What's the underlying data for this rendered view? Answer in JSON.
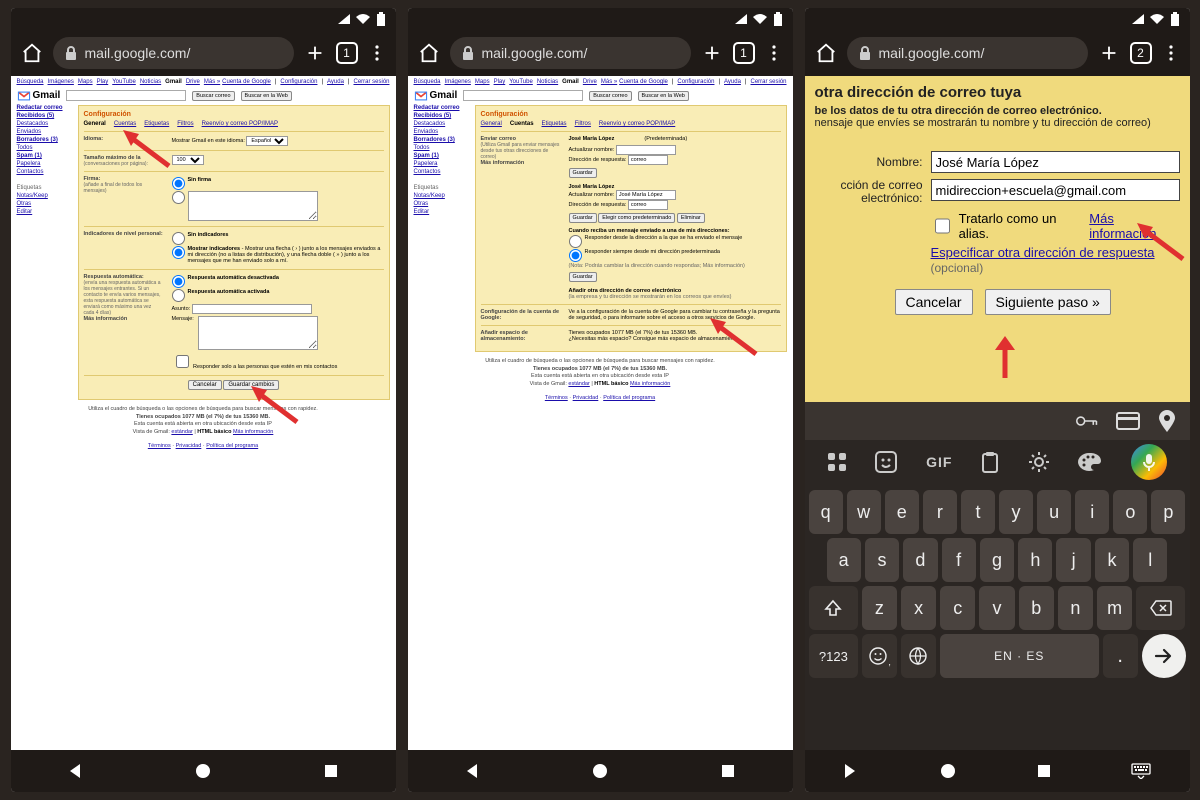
{
  "browser": {
    "url": "mail.google.com/",
    "tab_count_a": "1",
    "tab_count_b": "2"
  },
  "gmail_top": {
    "links": [
      "Búsqueda",
      "Imágenes",
      "Maps",
      "Play",
      "YouTube",
      "Noticias",
      "Gmail",
      "Drive",
      "Más »"
    ],
    "account_links": [
      "Cuenta de Google",
      "Configuración",
      "Ayuda",
      "Cerrar sesión"
    ],
    "logo": "Gmail",
    "btn_search_mail": "Buscar correo",
    "btn_search_web": "Buscar en la Web"
  },
  "sidebar": {
    "items": [
      "Redactar correo",
      "Recibidos (5)",
      "Destacados",
      "Enviados",
      "Borradores (3)",
      "Todos",
      "Spam (1)",
      "Papelera",
      "Contactos"
    ],
    "section": "Etiquetas",
    "labels": [
      "Notas/Keep",
      "Otras",
      "Editar"
    ]
  },
  "config": {
    "title": "Configuración",
    "tabs": [
      "General",
      "Cuentas",
      "Etiquetas",
      "Filtros",
      "Reenvío y correo POP/IMAP"
    ],
    "active_tab_p1": 0,
    "active_tab_p2": 1
  },
  "p1_rows": {
    "idioma": {
      "label": "Idioma:",
      "val_label": "Mostrar Gmail en este idioma:",
      "select": "Español"
    },
    "tamano": {
      "label": "Tamaño máximo de la",
      "sub": "(conversaciones por página):",
      "select": "100"
    },
    "firma": {
      "label": "Firma:",
      "sub": "(añade a final de todos los mensajes)",
      "radio1": "Sin firma"
    },
    "indicadores": {
      "label": "Indicadores de nivel personal:",
      "radio1": "Sin indicadores",
      "radio2": "Mostrar indicadores",
      "desc": "- Mostrar una flecha ( › ) junto a los mensajes enviados a mi dirección (no a listas de distribución), y una flecha doble ( » ) junto a los mensajes que me han enviado solo a mí."
    },
    "respuesta": {
      "label": "Respuesta automática:",
      "sub": "(envía una respuesta automática a los mensajes entrantes. Si un contacto te envía varios mensajes, esta respuesta automática se enviará como máximo una vez cada 4 días)",
      "more": "Más información",
      "radio1": "Respuesta automática desactivada",
      "radio2": "Respuesta automática activada",
      "asunto": "Asunto:",
      "mensaje": "Mensaje:",
      "chk": "Responder solo a las personas que estén en mis contactos"
    },
    "actions": {
      "cancel": "Cancelar",
      "save": "Guardar cambios"
    }
  },
  "p2_rows": {
    "enviar": {
      "label": "Enviar correo",
      "sub": "(Utiliza Gmail para enviar mensajes desde tus otras direcciones de correo)",
      "more": "Más información",
      "col_name": "José María López",
      "col_default": "(Predeterminada)",
      "actualizar_nombre": "Actualizar nombre:",
      "direccion_respuesta": "Dirección de respuesta:",
      "resp_val": "correo",
      "btn_guardar": "Guardar",
      "seg_nombre": "José María López",
      "btn_elegir": "Elegir como predeterminado",
      "btn_eliminar": "Eliminar",
      "cuando": "Cuando reciba un mensaje enviado a una de mis direcciones:",
      "opt1": "Responder desde la dirección a la que se ha enviado el mensaje",
      "opt2": "Responder siempre desde mi dirección predeterminada",
      "nota": "(Nota: Podrás cambiar la dirección cuando respondas; Más información)",
      "add_link": "Añadir otra dirección de correo electrónico",
      "add_sub": "(la empresa y tu dirección se mostrarán en los correos que envíes)"
    },
    "config_google": {
      "label": "Configuración de la cuenta de Google:",
      "text": "Ve a la configuración de la cuenta de Google para cambiar tu contraseña y la pregunta de seguridad, o para informarte sobre el acceso a otros servicios de Google."
    },
    "storage": {
      "label": "Añadir espacio de almacenamiento:",
      "line1": "Tienes ocupados 1077 MB (el 7%) de tus 15360 MB.",
      "line2": "¿Necesitas más espacio? Consigue más espacio de almacenamiento"
    }
  },
  "footer": {
    "search_tip": "Utiliza el cuadro de búsqueda o las opciones de búsqueda para buscar mensajes con rapidez.",
    "storage": "Tienes ocupados 1077 MB (el 7%) de tus 15360 MB.",
    "activity": "Esta cuenta está abierta en otra ubicación desde esta IP",
    "view1": "Vista de Gmail:",
    "estandar": "estándar",
    "html": "HTML básico",
    "more": "Más información",
    "bottom": [
      "Términos",
      "Privacidad",
      "Política del programa"
    ]
  },
  "p3": {
    "title": "otra dirección de correo tuya",
    "sub1": "be los datos de tu otra dirección de correo electrónico.",
    "sub2": "nensaje que envíes se mostrarán tu nombre y tu dirección de correo)",
    "lbl_nombre": "Nombre:",
    "val_nombre": "José María López",
    "lbl_direccion": "cción de correo electrónico:",
    "val_direccion": "midireccion+escuela@gmail.com",
    "alias": "Tratarlo como un alias.",
    "more": "Más información",
    "spec": "Especificar otra dirección de respuesta",
    "opt": "(opcional)",
    "btn_cancel": "Cancelar",
    "btn_next": "Siguiente paso »"
  },
  "keyboard": {
    "gif": "GIF",
    "rows": [
      [
        "q",
        "w",
        "e",
        "r",
        "t",
        "y",
        "u",
        "i",
        "o",
        "p"
      ],
      [
        "a",
        "s",
        "d",
        "f",
        "g",
        "h",
        "j",
        "k",
        "l"
      ],
      [
        "⇧",
        "z",
        "x",
        "c",
        "v",
        "b",
        "n",
        "m",
        "⌫"
      ],
      [
        "?123",
        "☺",
        "🌐",
        "EN · ES",
        ".",
        "→"
      ]
    ],
    "space": "EN · ES"
  }
}
